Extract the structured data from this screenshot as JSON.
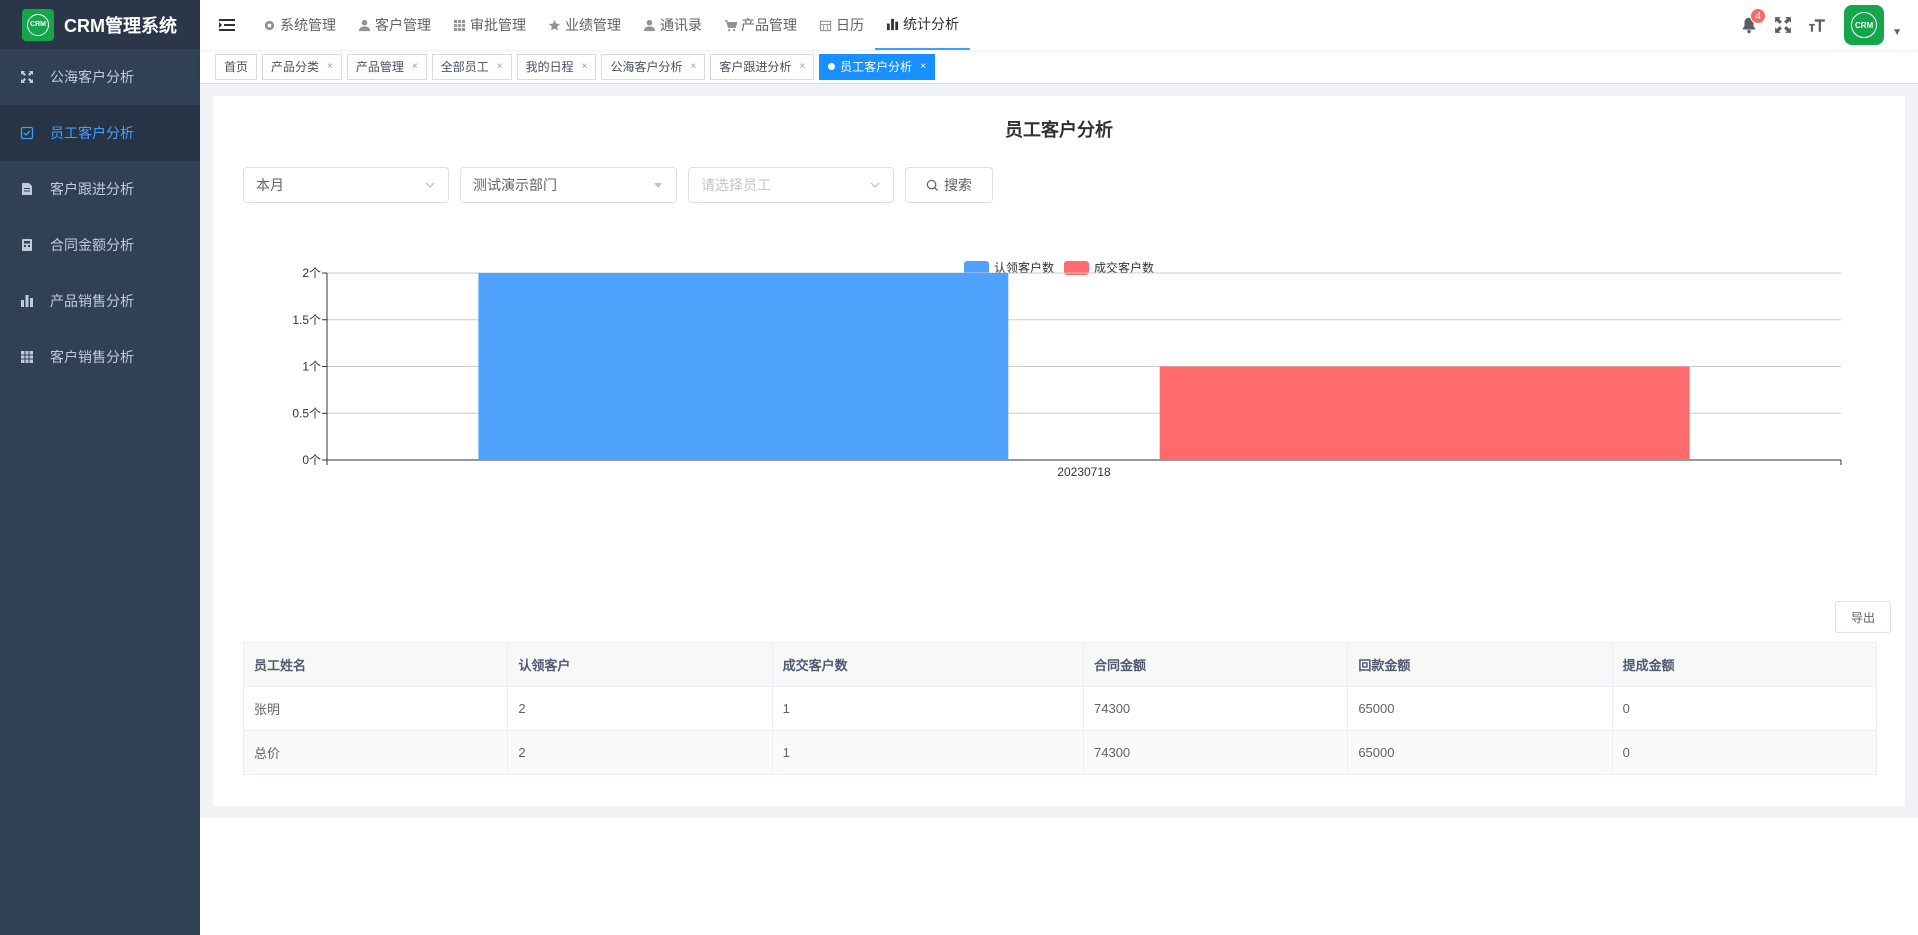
{
  "app": {
    "logo_text": "CRM",
    "title": "CRM管理系统"
  },
  "sidebar": {
    "items": [
      {
        "label": "公海客户分析",
        "icon": "fullscreen-icon",
        "active": false
      },
      {
        "label": "员工客户分析",
        "icon": "check-box-icon",
        "active": true
      },
      {
        "label": "客户跟进分析",
        "icon": "document-icon",
        "active": false
      },
      {
        "label": "合同金额分析",
        "icon": "calculator-icon",
        "active": false
      },
      {
        "label": "产品销售分析",
        "icon": "bar-chart-icon",
        "active": false
      },
      {
        "label": "客户销售分析",
        "icon": "table-icon",
        "active": false
      }
    ]
  },
  "topnav": {
    "items": [
      {
        "label": "系统管理",
        "icon": "gear-icon"
      },
      {
        "label": "客户管理",
        "icon": "user-icon"
      },
      {
        "label": "审批管理",
        "icon": "grid-icon"
      },
      {
        "label": "业绩管理",
        "icon": "star-icon"
      },
      {
        "label": "通讯录",
        "icon": "user-icon"
      },
      {
        "label": "产品管理",
        "icon": "cart-icon"
      },
      {
        "label": "日历",
        "icon": "calendar-icon"
      },
      {
        "label": "统计分析",
        "icon": "bar-chart-icon"
      }
    ],
    "active_index": 7,
    "notification_count": "4",
    "avatar_text": "CRM"
  },
  "tags": [
    {
      "label": "首页",
      "closable": false,
      "active": false
    },
    {
      "label": "产品分类",
      "closable": true,
      "active": false
    },
    {
      "label": "产品管理",
      "closable": true,
      "active": false
    },
    {
      "label": "全部员工",
      "closable": true,
      "active": false
    },
    {
      "label": "我的日程",
      "closable": true,
      "active": false
    },
    {
      "label": "公海客户分析",
      "closable": true,
      "active": false
    },
    {
      "label": "客户跟进分析",
      "closable": true,
      "active": false
    },
    {
      "label": "员工客户分析",
      "closable": true,
      "active": true
    }
  ],
  "page": {
    "title": "员工客户分析",
    "filters": {
      "period": "本月",
      "department": "测试演示部门",
      "employee_placeholder": "请选择员工",
      "search_label": "搜索"
    },
    "export_label": "导出"
  },
  "chart_data": {
    "type": "bar",
    "categories": [
      "20230718"
    ],
    "series": [
      {
        "name": "认领客户数",
        "values": [
          2
        ],
        "color": "#4fa3fc"
      },
      {
        "name": "成交客户数",
        "values": [
          1
        ],
        "color": "#ff6a6c"
      }
    ],
    "y_ticks": [
      "0个",
      "0.5个",
      "1个",
      "1.5个",
      "2个"
    ],
    "ylim": [
      0,
      2
    ],
    "grid": true,
    "legend": "top-center"
  },
  "table": {
    "columns": [
      "员工姓名",
      "认领客户",
      "成交客户数",
      "合同金额",
      "回款金额",
      "提成金额"
    ],
    "rows": [
      [
        "张明",
        "2",
        "1",
        "74300",
        "65000",
        "0"
      ],
      [
        "总价",
        "2",
        "1",
        "74300",
        "65000",
        "0"
      ]
    ]
  }
}
